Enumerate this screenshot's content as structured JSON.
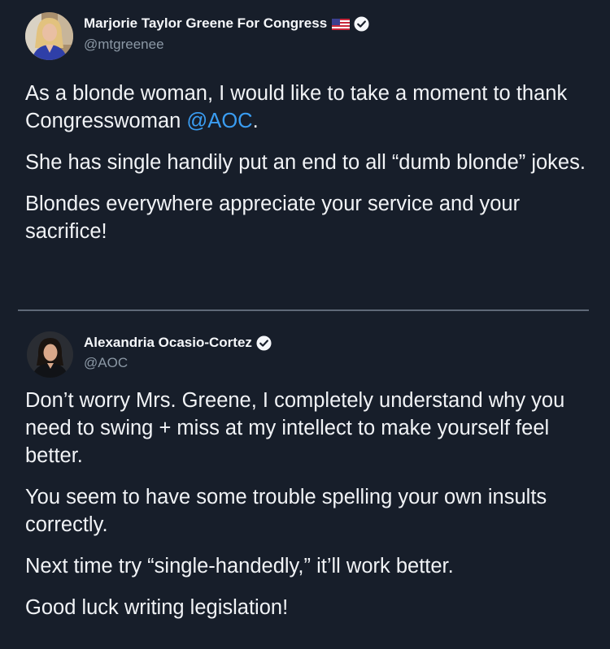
{
  "tweets": [
    {
      "author_name": "Marjorie Taylor Greene For Congress",
      "handle": "@mtgreenee",
      "paragraphs": [
        {
          "before": "As a blonde woman, I would like to take a moment to thank Congresswoman ",
          "mention": "@AOC",
          "after": "."
        },
        {
          "text": "She has single handily put an end to all “dumb blonde” jokes."
        },
        {
          "text": "Blondes everywhere appreciate your service and your sacrifice!"
        }
      ],
      "icons": [
        "us-flag-icon",
        "verified-icon"
      ]
    },
    {
      "author_name": "Alexandria Ocasio-Cortez",
      "handle": "@AOC",
      "paragraphs": [
        {
          "text": "Don’t worry Mrs. Greene, I completely understand why you need to swing + miss at my intellect to make yourself feel better."
        },
        {
          "text": "You seem to have some trouble spelling your own insults correctly."
        },
        {
          "text": "Next time try “single-handedly,” it’ll work better."
        },
        {
          "text": "Good luck writing legislation!"
        }
      ],
      "icons": [
        "verified-icon"
      ]
    }
  ],
  "colors": {
    "background": "#171e2a",
    "text": "#f1f3f6",
    "handle": "#8b98a5",
    "mention": "#3a9df2",
    "divider": "#5f6978"
  }
}
